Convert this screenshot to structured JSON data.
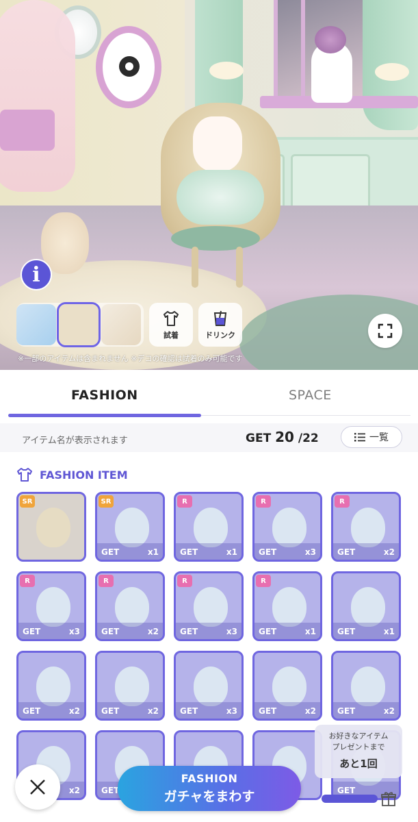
{
  "scene": {
    "info_label": "i",
    "try_on_label": "試着",
    "drink_label": "ドリンク",
    "notice": "※一部のアイテムは含まれません ※デコの確認は試着のみ可能です"
  },
  "tabs": [
    {
      "label": "FASHION",
      "active": true
    },
    {
      "label": "SPACE",
      "active": false
    }
  ],
  "subbar": {
    "item_name_placeholder": "アイテム名が表示されます",
    "get_prefix": "GET ",
    "get_owned": "20",
    "get_total": " /22",
    "list_button_label": "一覧"
  },
  "section": {
    "title": "FASHION ITEM"
  },
  "items": [
    {
      "rarity": "SR",
      "get": "",
      "count": "",
      "selected": true
    },
    {
      "rarity": "SR",
      "get": "GET",
      "count": "x1"
    },
    {
      "rarity": "R",
      "get": "GET",
      "count": "x1"
    },
    {
      "rarity": "R",
      "get": "GET",
      "count": "x3"
    },
    {
      "rarity": "R",
      "get": "GET",
      "count": "x2"
    },
    {
      "rarity": "R",
      "get": "GET",
      "count": "x3"
    },
    {
      "rarity": "R",
      "get": "GET",
      "count": "x2"
    },
    {
      "rarity": "R",
      "get": "GET",
      "count": "x3"
    },
    {
      "rarity": "R",
      "get": "GET",
      "count": "x1"
    },
    {
      "rarity": "",
      "get": "GET",
      "count": "x1"
    },
    {
      "rarity": "",
      "get": "GET",
      "count": "x2"
    },
    {
      "rarity": "",
      "get": "GET",
      "count": "x2"
    },
    {
      "rarity": "",
      "get": "GET",
      "count": "x3"
    },
    {
      "rarity": "",
      "get": "GET",
      "count": "x2"
    },
    {
      "rarity": "",
      "get": "GET",
      "count": "x2"
    },
    {
      "rarity": "",
      "get": "",
      "count": "x2"
    },
    {
      "rarity": "",
      "get": "GET",
      "count": ""
    },
    {
      "rarity": "",
      "get": "",
      "count": ""
    },
    {
      "rarity": "",
      "get": "",
      "count": ""
    },
    {
      "rarity": "",
      "get": "GET",
      "count": ""
    }
  ],
  "promo": {
    "line1": "お好きなアイテム",
    "line2": "プレゼントまで",
    "line3": "あと1回"
  },
  "gacha": {
    "line1": "FASHION",
    "line2": "ガチャをまわす"
  },
  "colors": {
    "accent": "#6f66e0",
    "sr": "#f0a43a",
    "r": "#e76fb0",
    "gacha_start": "#2aa4e0",
    "gacha_end": "#7d5be6"
  }
}
